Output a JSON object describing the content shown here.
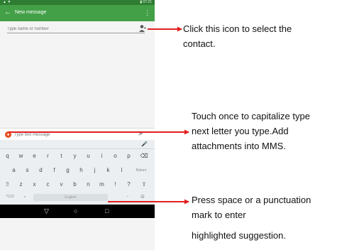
{
  "statusbar": {
    "signal": "▲ ▼",
    "time": "▮ 07:21"
  },
  "appbar": {
    "back_icon": "←",
    "title": "New message",
    "more_icon": "⋮"
  },
  "recipient": {
    "placeholder": "Type name or number"
  },
  "compose": {
    "attach_icon": "+",
    "placeholder": "Type text message",
    "send_icon": "➤"
  },
  "keyboard": {
    "mic_icon": "🎤",
    "row1": [
      "q",
      "w",
      "e",
      "r",
      "t",
      "y",
      "u",
      "i",
      "o",
      "p",
      "⌫"
    ],
    "row2": [
      "a",
      "s",
      "d",
      "f",
      "g",
      "h",
      "j",
      "k",
      "l",
      "Return"
    ],
    "row3": [
      "⇧",
      "z",
      "x",
      "c",
      "v",
      "b",
      "n",
      "m",
      "!",
      "?",
      "⇧"
    ],
    "row4": {
      "symbols": "?123",
      "comma": ",",
      "space": "English",
      "period": ".",
      "emoji": "☺"
    }
  },
  "navbar": {
    "back": "▽",
    "home": "○",
    "recents": "□"
  },
  "callouts": {
    "contact": [
      "Click this icon to select the",
      "contact."
    ],
    "shift": [
      "Touch once to capitalize type",
      "next letter you type.Add",
      "attachments into MMS."
    ],
    "space": [
      "Press space or a punctuation",
      "mark to enter",
      "highlighted suggestion."
    ]
  },
  "colors": {
    "arrow": "#e02020",
    "appbar": "#43a047",
    "statusbar": "#2e7d32"
  }
}
